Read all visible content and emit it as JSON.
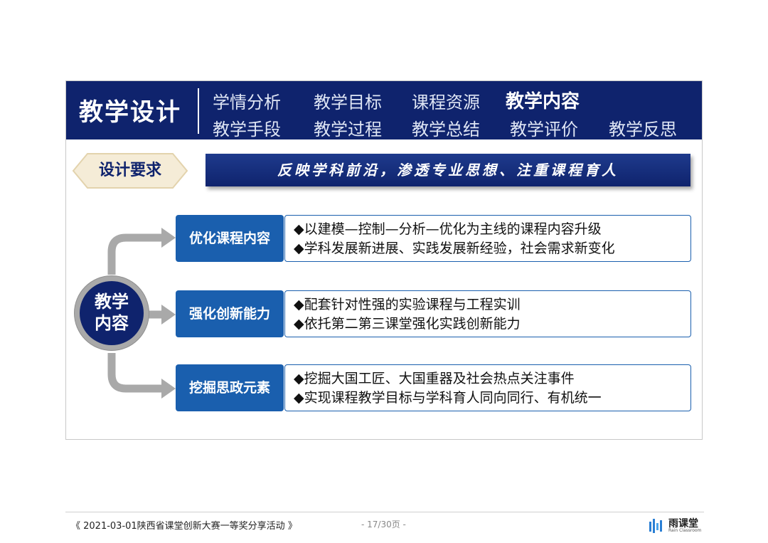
{
  "header": {
    "title": "教学设计",
    "nav": [
      {
        "label": "学情分析"
      },
      {
        "label": "教学目标"
      },
      {
        "label": "课程资源"
      },
      {
        "label": "教学内容",
        "active": true
      },
      {
        "label": "教学手段"
      },
      {
        "label": "教学过程"
      },
      {
        "label": "教学总结"
      },
      {
        "label": "教学评价"
      },
      {
        "label": "教学反思"
      }
    ]
  },
  "requirement": {
    "tag": "设计要求",
    "text": "反映学科前沿，渗透专业思想、注重课程育人"
  },
  "center": {
    "line1": "教学",
    "line2": "内容"
  },
  "sections": [
    {
      "title": "优化课程内容",
      "points": [
        "◆以建模—控制—分析—优化为主线的课程内容升级",
        "◆学科发展新进展、实践发展新经验，社会需求新变化"
      ]
    },
    {
      "title": "强化创新能力",
      "points": [
        "◆配套针对性强的实验课程与工程实训",
        "◆依托第二第三课堂强化实践创新能力"
      ]
    },
    {
      "title": "挖掘思政元素",
      "points": [
        "◆挖掘大国工匠、大国重器及社会热点关注事件",
        "◆实现课程教学目标与学科育人同向同行、有机统一"
      ]
    }
  ],
  "footer": {
    "event": "《 2021-03-01陕西省课堂创新大赛一等奖分享活动 》",
    "page": "- 17/30页 -",
    "brand": "雨课堂",
    "brand_sub": "Rain Classroom"
  },
  "colors": {
    "navy": "#0f236d",
    "blue": "#1a5fae",
    "tag_bg": "#f5ecd7",
    "arrow_gray": "#a9a9a9"
  }
}
